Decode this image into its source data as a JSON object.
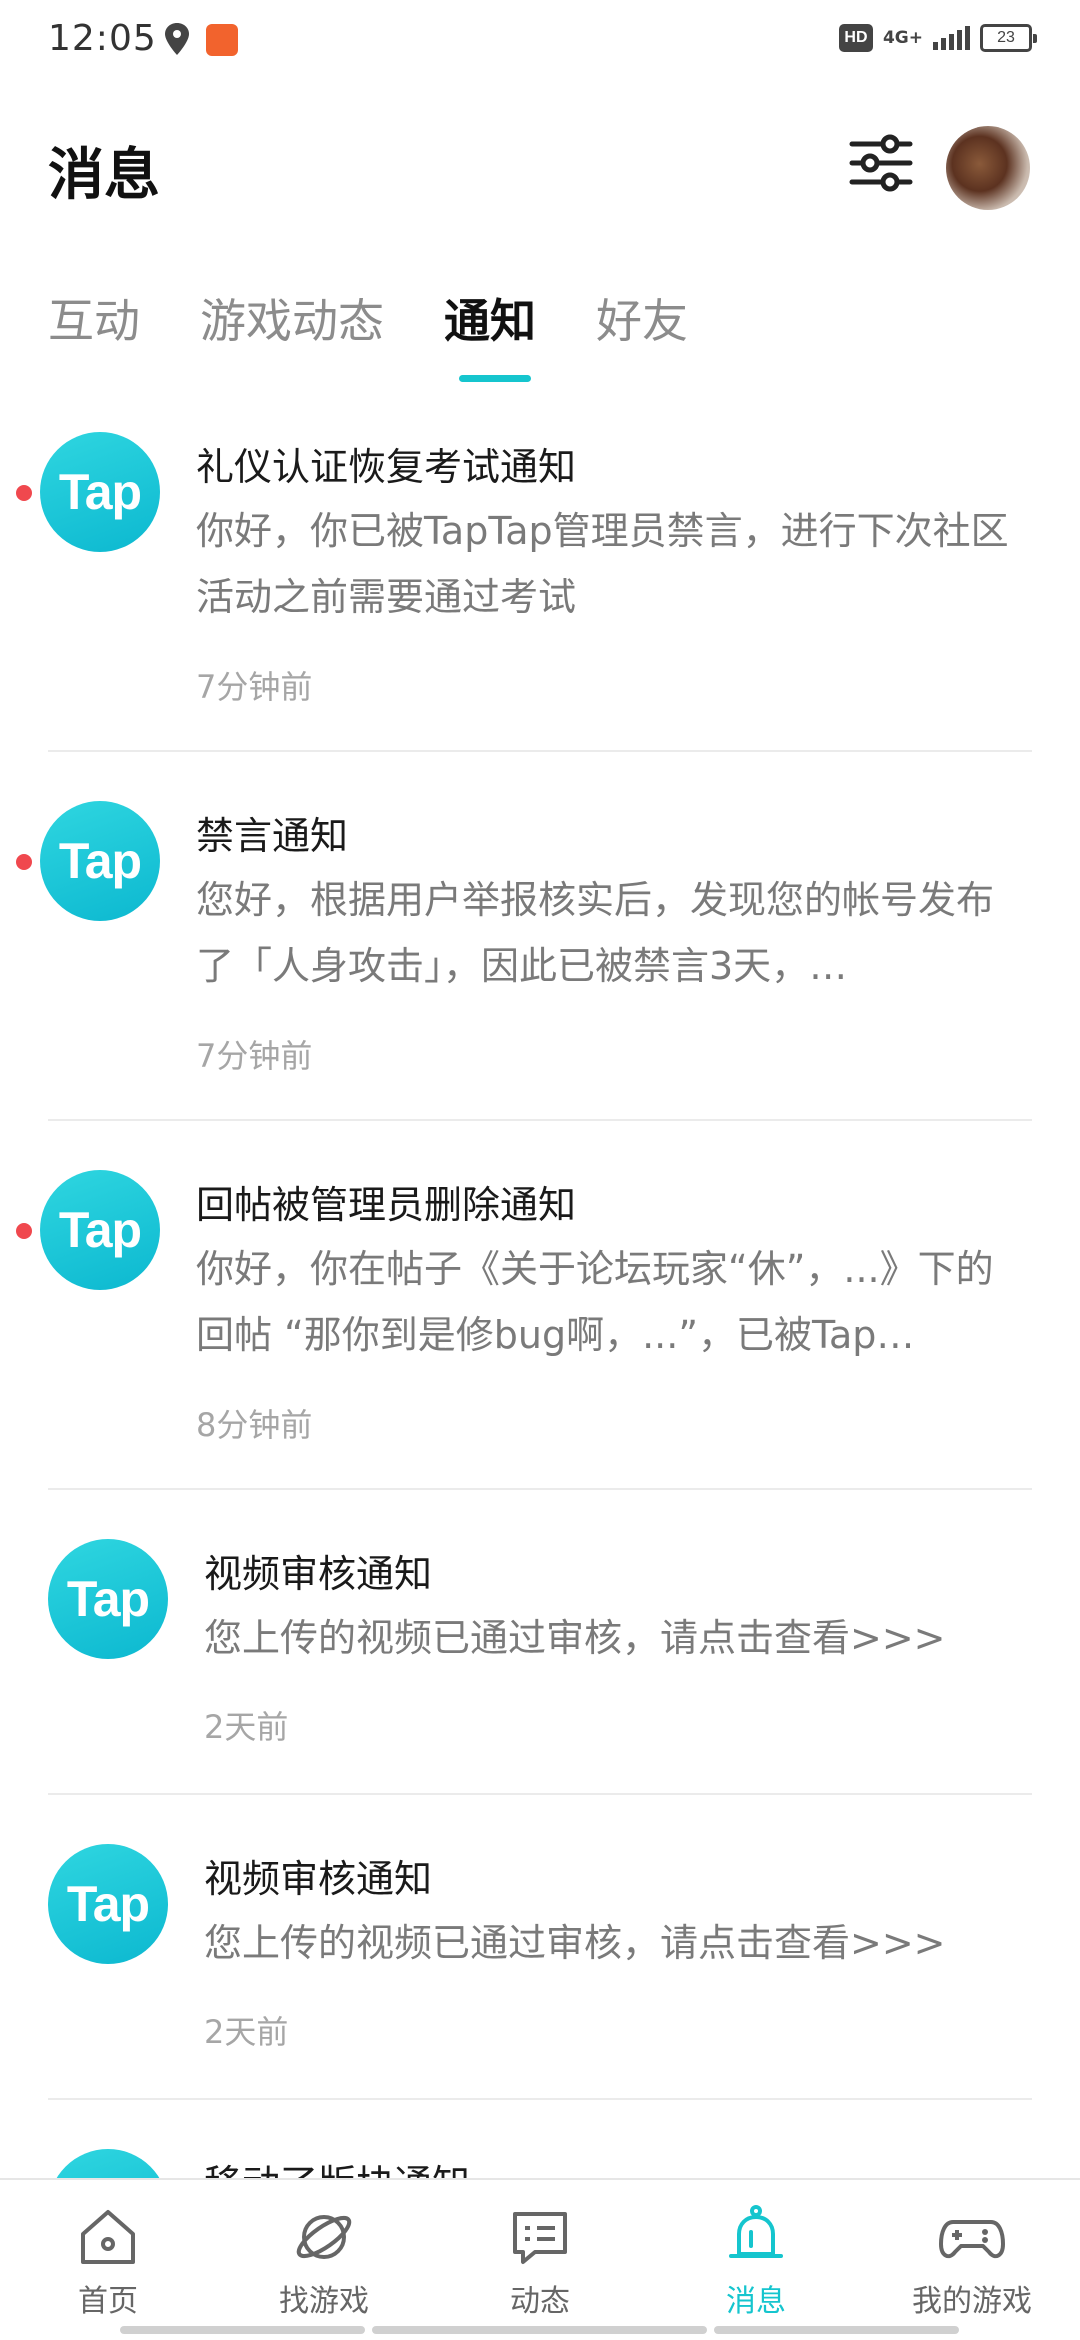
{
  "status_bar": {
    "time": "12:05",
    "hd": "HD",
    "network": "4G+",
    "battery": "23"
  },
  "header": {
    "title": "消息"
  },
  "tabs": [
    {
      "label": "互动",
      "active": false
    },
    {
      "label": "游戏动态",
      "active": false
    },
    {
      "label": "通知",
      "active": true
    },
    {
      "label": "好友",
      "active": false
    }
  ],
  "notifications": [
    {
      "logo": "Tap",
      "unread": true,
      "title": "礼仪认证恢复考试通知",
      "body": "你好，你已被TapTap管理员禁言，进行下次社区活动之前需要通过考试",
      "time": "7分钟前"
    },
    {
      "logo": "Tap",
      "unread": true,
      "title": "禁言通知",
      "body": "您好，根据用户举报核实后，发现您的帐号发布了「人身攻击」，因此已被禁言3天，…",
      "time": "7分钟前"
    },
    {
      "logo": "Tap",
      "unread": true,
      "title": "回帖被管理员删除通知",
      "body": "你好，你在帖子《关于论坛玩家“休”，...》下的回帖 “那你到是修bug啊，...”，已被Tap…",
      "time": "8分钟前"
    },
    {
      "logo": "Tap",
      "unread": false,
      "title": "视频审核通知",
      "body": "您上传的视频已通过审核，请点击查看>>>",
      "time": "2天前"
    },
    {
      "logo": "Tap",
      "unread": false,
      "title": "视频审核通知",
      "body": "您上传的视频已通过审核，请点击查看>>>",
      "time": "2天前"
    },
    {
      "logo": "Tap",
      "unread": false,
      "title": "移动了版块通知",
      "body": "",
      "time": ""
    }
  ],
  "bottom_nav": [
    {
      "label": "首页",
      "icon": "home-icon",
      "active": false
    },
    {
      "label": "找游戏",
      "icon": "planet-icon",
      "active": false
    },
    {
      "label": "动态",
      "icon": "chat-icon",
      "active": false
    },
    {
      "label": "消息",
      "icon": "bell-icon",
      "active": true
    },
    {
      "label": "我的游戏",
      "icon": "gamepad-icon",
      "active": false
    }
  ],
  "colors": {
    "accent": "#15c5ce",
    "unread_dot": "#f0484e",
    "logo": "#0cb8d0"
  }
}
